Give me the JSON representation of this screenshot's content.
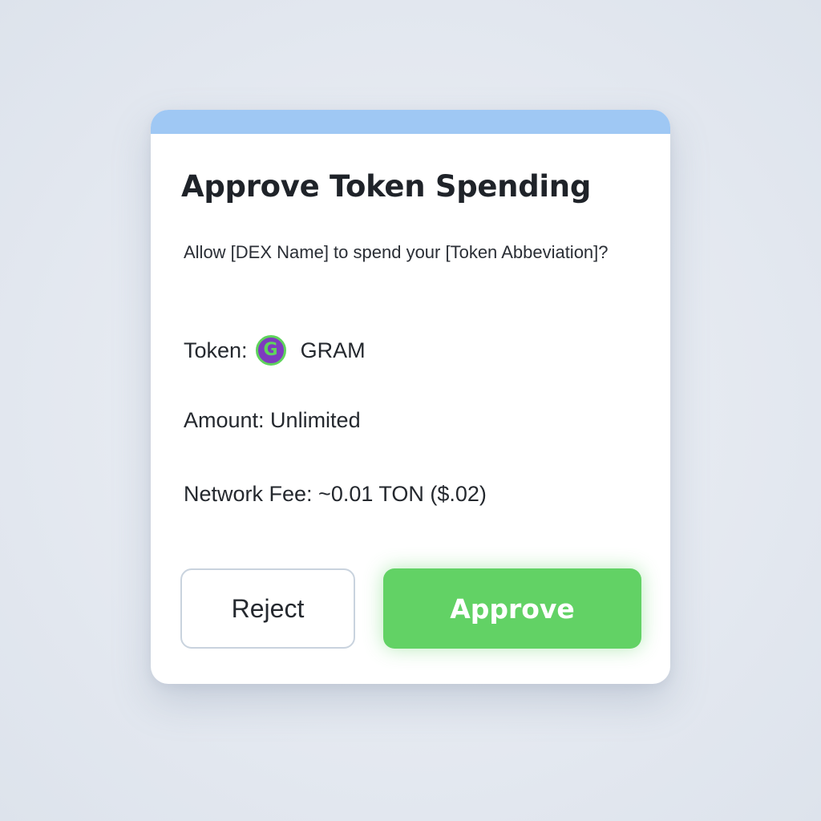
{
  "dialog": {
    "title": "Approve Token Spending",
    "subtitle": "Allow [DEX Name] to spend your [Token Abbeviation]?",
    "token_label": "Token:",
    "token_icon": "gram-token-icon",
    "token_icon_letter": "G",
    "token_value": "GRAM",
    "amount_text": "Amount: Unlimited",
    "fee_text": "Network Fee: ~0.01 TON ($.02)",
    "reject_label": "Reject",
    "approve_label": "Approve"
  },
  "colors": {
    "header_bar": "#9fc8f4",
    "approve_button": "#62d265",
    "token_icon_fill": "#7e3bbf",
    "token_icon_ring": "#5fd35c"
  }
}
